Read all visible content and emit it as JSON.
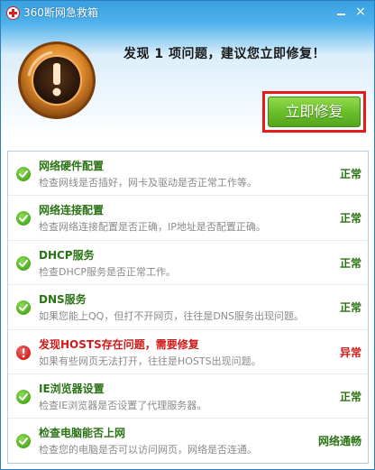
{
  "window": {
    "title": "360断网急救箱",
    "minimize_label": "",
    "close_label": "×"
  },
  "header": {
    "headline": "发现 1 项问题，建议您立即修复！",
    "fix_button": "立即修复"
  },
  "colors": {
    "ok": "#4cac1c",
    "error": "#d42020",
    "accent_green": "#6bbf2b",
    "highlight_red": "#e41b1b"
  },
  "items": [
    {
      "title": "网络硬件配置",
      "desc": "检查网线是否插好，网卡及驱动是否正常工作等。",
      "status": "正常",
      "state": "ok",
      "icon": "check-icon"
    },
    {
      "title": "网络连接配置",
      "desc": "检查网络连接配置是否正确，IP地址是否配置正确。",
      "status": "正常",
      "state": "ok",
      "icon": "check-icon"
    },
    {
      "title": "DHCP服务",
      "desc": "检查DHCP服务是否正常工作。",
      "status": "正常",
      "state": "ok",
      "icon": "check-icon"
    },
    {
      "title": "DNS服务",
      "desc": "如果您能上QQ，但打不开网页，往往是DNS服务出现问题。",
      "status": "正常",
      "state": "ok",
      "icon": "check-icon"
    },
    {
      "title": "发现HOSTS存在问题，需要修复",
      "desc": "如果有些网页无法打开，往往是HOSTS出现问题。",
      "status": "异常",
      "state": "error",
      "icon": "exclamation-icon"
    },
    {
      "title": "IE浏览器设置",
      "desc": "检查IE浏览器是否设置了代理服务器。",
      "status": "正常",
      "state": "ok",
      "icon": "check-icon"
    },
    {
      "title": "检查电脑能否上网",
      "desc": "检查您的电脑是否可以访问网页，网络是否连通。",
      "status": "网络通畅",
      "state": "ok",
      "icon": "check-icon"
    }
  ]
}
